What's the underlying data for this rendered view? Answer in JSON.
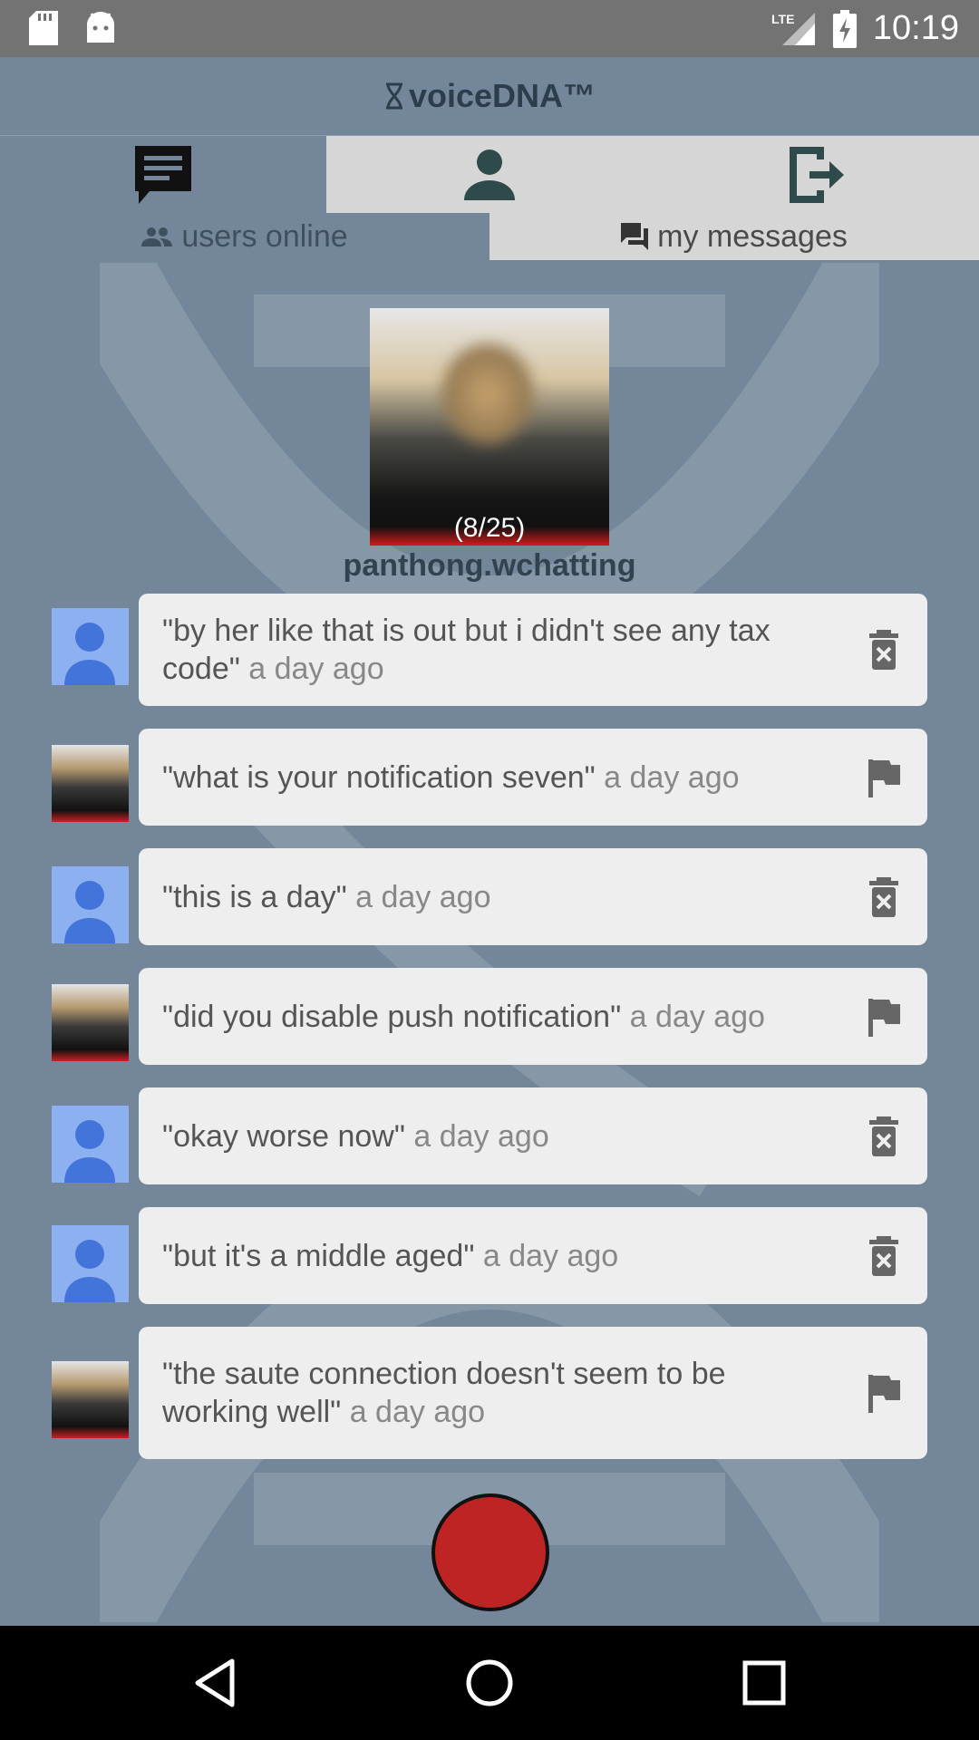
{
  "status_bar": {
    "time": "10:19",
    "network": "LTE"
  },
  "app": {
    "title": "voiceDNA™"
  },
  "tabs": [
    {
      "icon": "chat-icon",
      "active": true
    },
    {
      "icon": "person-icon",
      "active": false
    },
    {
      "icon": "logout-icon",
      "active": false
    }
  ],
  "subtabs": [
    {
      "icon": "people-icon",
      "label": "users online"
    },
    {
      "icon": "messages-icon",
      "label": "my messages"
    }
  ],
  "profile": {
    "count": "(8/25)",
    "username": "panthong.wchatting"
  },
  "messages": [
    {
      "text": "\"by her like that is out but i didn't see any tax code\"",
      "time": "a day ago",
      "avatar": "default",
      "action": "delete-icon"
    },
    {
      "text": "\"what is your notification seven\"",
      "time": "a day ago",
      "avatar": "photo",
      "action": "flag-icon"
    },
    {
      "text": "\"this is a day\"",
      "time": "a day ago",
      "avatar": "default",
      "action": "delete-icon"
    },
    {
      "text": "\"did you disable push notification\"",
      "time": "a day ago",
      "avatar": "photo",
      "action": "flag-icon"
    },
    {
      "text": "\"okay worse now\"",
      "time": "a day ago",
      "avatar": "default",
      "action": "delete-icon"
    },
    {
      "text": "\"but it's a middle aged\"",
      "time": "a day ago",
      "avatar": "default",
      "action": "delete-icon"
    },
    {
      "text": "\"the saute connection doesn't seem to be working well\"",
      "time": "a day ago",
      "avatar": "photo",
      "action": "flag-icon"
    }
  ],
  "colors": {
    "accent": "#74879a",
    "record": "#bf2424",
    "tab_inactive": "#d6d6d6",
    "bubble": "#eeeeee",
    "avatar_default": "#8db0f0"
  }
}
